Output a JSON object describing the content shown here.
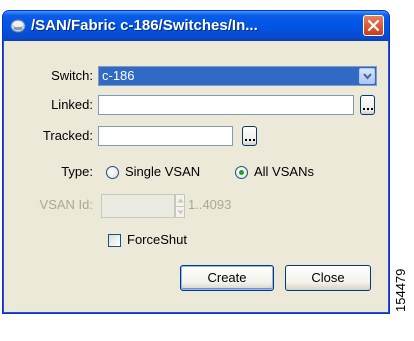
{
  "window": {
    "title": "/SAN/Fabric c-186/Switches/In...",
    "app_icon": "fabric-manager-icon",
    "close_icon": "close-icon"
  },
  "form": {
    "switch_label": "Switch:",
    "switch_value": "c-186",
    "linked_label": "Linked:",
    "linked_value": "",
    "tracked_label": "Tracked:",
    "tracked_value": "",
    "type_label": "Type:",
    "type_options": [
      {
        "label": "Single VSAN",
        "selected": false
      },
      {
        "label": "All VSANs",
        "selected": true
      }
    ],
    "vsan_id_label": "VSAN Id:",
    "vsan_id_value": "",
    "vsan_id_range": "1..4093",
    "forceshut_label": "ForceShut",
    "forceshut_checked": false
  },
  "buttons": {
    "create": "Create",
    "close": "Close"
  },
  "figure_id": "154479",
  "colors": {
    "titlebar": "#0054e3",
    "dialog_bg": "#ece9d8",
    "selection": "#316ac5",
    "close_button": "#cc3b14"
  }
}
